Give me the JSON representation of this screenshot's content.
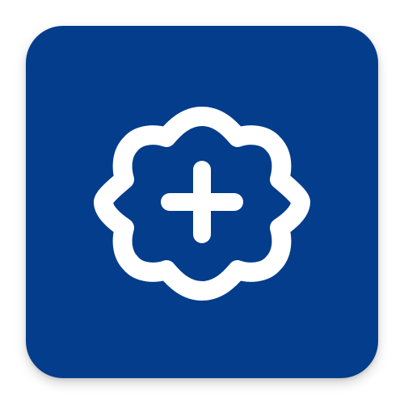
{
  "app_icon": {
    "icon": "badge-plus-icon",
    "background_color": "#033D8B",
    "foreground_color": "#FFFFFF"
  }
}
